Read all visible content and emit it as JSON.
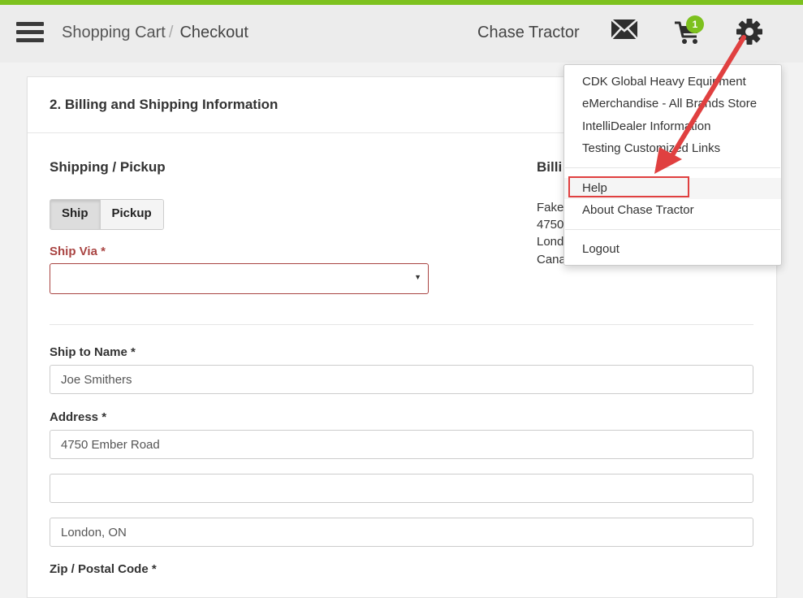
{
  "header": {
    "breadcrumb": [
      {
        "label": "Shopping Cart"
      },
      {
        "label": "Checkout"
      }
    ],
    "breadcrumb_separator": "/",
    "store_name": "Chase Tractor",
    "cart_count": "1",
    "icons": {
      "menu": "hamburger-menu-icon",
      "mail": "envelope-icon",
      "cart": "shopping-cart-icon",
      "settings": "gear-icon"
    },
    "accent_color": "#7dc11e"
  },
  "checkout": {
    "section_title": "2. Billing and Shipping Information",
    "shipping": {
      "title": "Shipping / Pickup",
      "toggle": {
        "ship_label": "Ship",
        "pickup_label": "Pickup",
        "selected": "Ship"
      },
      "ship_via_label": "Ship Via *",
      "ship_via_value": "",
      "ship_to_name_label": "Ship to Name *",
      "ship_to_name_value": "Joe Smithers",
      "address_label": "Address *",
      "address_line1": "4750 Ember Road",
      "address_line2": "",
      "address_line3": "London, ON",
      "zip_label": "Zip / Postal Code *"
    },
    "billing": {
      "title_partial": "Billi",
      "lines": [
        "Fake",
        "4750",
        "Lond",
        "Cana"
      ]
    }
  },
  "settings_menu": {
    "group1": [
      {
        "label": "CDK Global Heavy Equipment"
      },
      {
        "label": "eMerchandise - All Brands Store"
      },
      {
        "label": "IntelliDealer Information"
      },
      {
        "label": "Testing Customized Links"
      }
    ],
    "group2": [
      {
        "label": "Help"
      },
      {
        "label": "About Chase Tractor"
      }
    ],
    "group3": [
      {
        "label": "Logout"
      }
    ]
  }
}
